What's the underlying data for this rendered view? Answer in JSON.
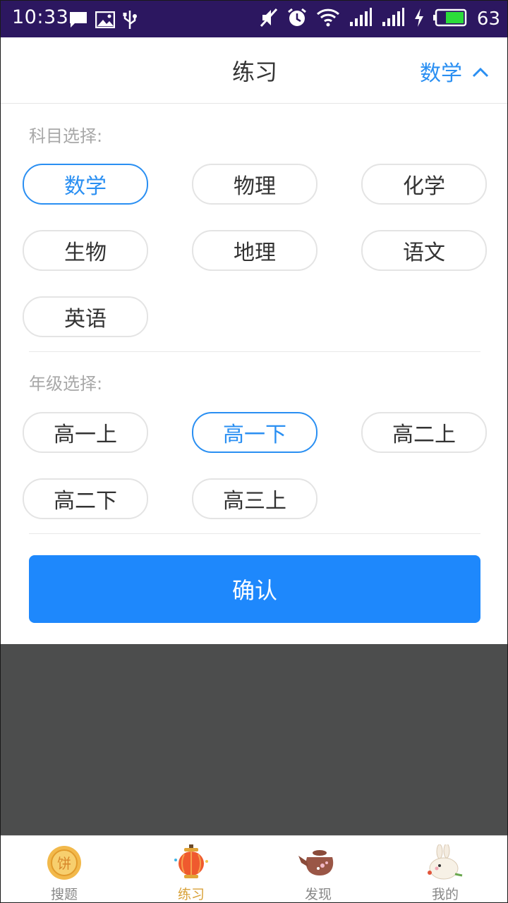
{
  "status_bar": {
    "time": "10:33",
    "battery": "63",
    "left_icons": [
      "message-icon",
      "image-icon",
      "usb-icon"
    ],
    "right_icons": [
      "mute-icon",
      "alarm-icon",
      "wifi-icon",
      "signal-icon",
      "signal-icon",
      "charging-icon",
      "battery-icon"
    ]
  },
  "header": {
    "title": "练习",
    "subject": "数学",
    "toggle_icon": "chevron-up-icon"
  },
  "subject_section": {
    "label": "科目选择:",
    "options": [
      "数学",
      "物理",
      "化学",
      "生物",
      "地理",
      "语文",
      "英语"
    ],
    "selected": "数学"
  },
  "grade_section": {
    "label": "年级选择:",
    "options": [
      "高一上",
      "高一下",
      "高二上",
      "高二下",
      "高三上"
    ],
    "selected": "高一下"
  },
  "confirm_label": "确认",
  "tab_bar": {
    "items": [
      {
        "label": "搜题",
        "icon": "mooncake-icon",
        "active": false
      },
      {
        "label": "练习",
        "icon": "lantern-icon",
        "active": true
      },
      {
        "label": "发现",
        "icon": "teapot-icon",
        "active": false
      },
      {
        "label": "我的",
        "icon": "rabbit-icon",
        "active": false
      }
    ]
  },
  "colors": {
    "status_bar": "#2c1760",
    "accent": "#2a8ff2",
    "confirm_button": "#1e88fc",
    "overlay": "#4c4d4d",
    "active_tab": "#d9a23a"
  }
}
